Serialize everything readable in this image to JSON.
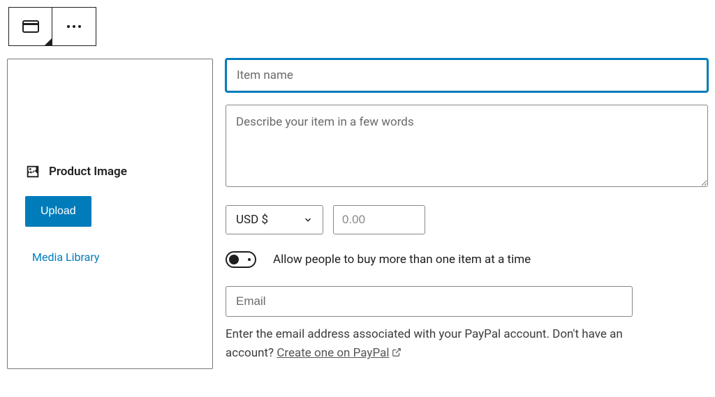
{
  "toolbar": {
    "block_icon": "payment-block",
    "more_icon": "more-options"
  },
  "sidebar": {
    "product_image_label": "Product Image",
    "upload_label": "Upload",
    "media_library_label": "Media Library"
  },
  "form": {
    "item_name_placeholder": "Item name",
    "item_name_value": "",
    "description_placeholder": "Describe your item in a few words",
    "description_value": "",
    "currency_label": "USD $",
    "price_placeholder": "0.00",
    "price_value": "",
    "toggle_label": "Allow people to buy more than one item at a time",
    "toggle_state": false,
    "email_placeholder": "Email",
    "email_value": "",
    "help_text_prefix": "Enter the email address associated with your PayPal account. Don't have an account? ",
    "help_link_text": "Create one on PayPal"
  }
}
